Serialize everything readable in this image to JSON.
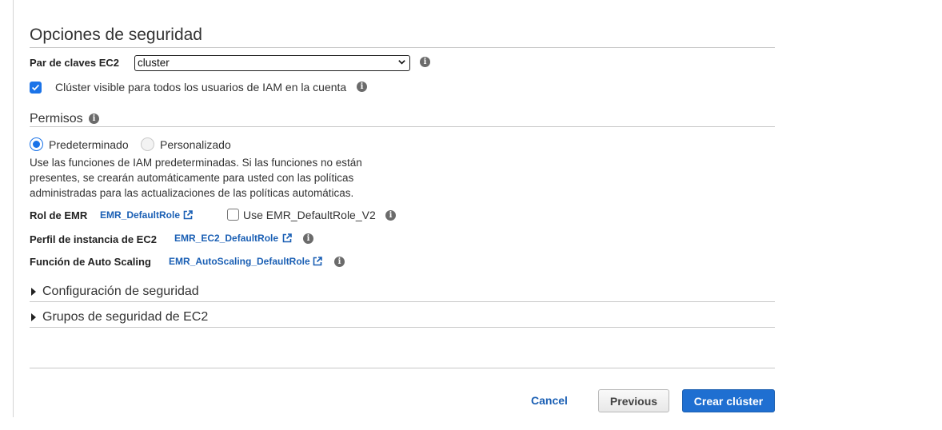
{
  "security": {
    "title": "Opciones de seguridad",
    "keypair_label": "Par de claves EC2",
    "keypair_value": "cluster",
    "visible_checkbox_label": "Clúster visible para todos los usuarios de IAM en la cuenta",
    "visible_checked": true
  },
  "permissions": {
    "title": "Permisos",
    "radio_default": "Predeterminado",
    "radio_custom": "Personalizado",
    "selected": "Predeterminado",
    "description": "Use las funciones de IAM predeterminadas. Si las funciones no están presentes, se crearán automáticamente para usted con las políticas administradas para las actualizaciones de las políticas automáticas.",
    "emr_role_label": "Rol de EMR",
    "emr_role_link": "EMR_DefaultRole",
    "use_v2_label": "Use EMR_DefaultRole_V2",
    "use_v2_checked": false,
    "ec2_profile_label": "Perfil de instancia de EC2",
    "ec2_profile_link": "EMR_EC2_DefaultRole",
    "autoscaling_label": "Función de Auto Scaling",
    "autoscaling_link": "EMR_AutoScaling_DefaultRole"
  },
  "collapsibles": {
    "security_config": "Configuración de seguridad",
    "security_groups": "Grupos de seguridad de EC2"
  },
  "footer": {
    "cancel": "Cancel",
    "previous": "Previous",
    "create": "Crear clúster"
  },
  "icons": {
    "info": "info-icon",
    "external_link": "external-link-icon",
    "caret_right": "caret-right-icon",
    "check": "checkmark-icon",
    "chevron_down": "chevron-down-icon"
  },
  "colors": {
    "accent": "#1a73e8",
    "link": "#1a5fb4",
    "primary_button": "#1f6fd1"
  }
}
